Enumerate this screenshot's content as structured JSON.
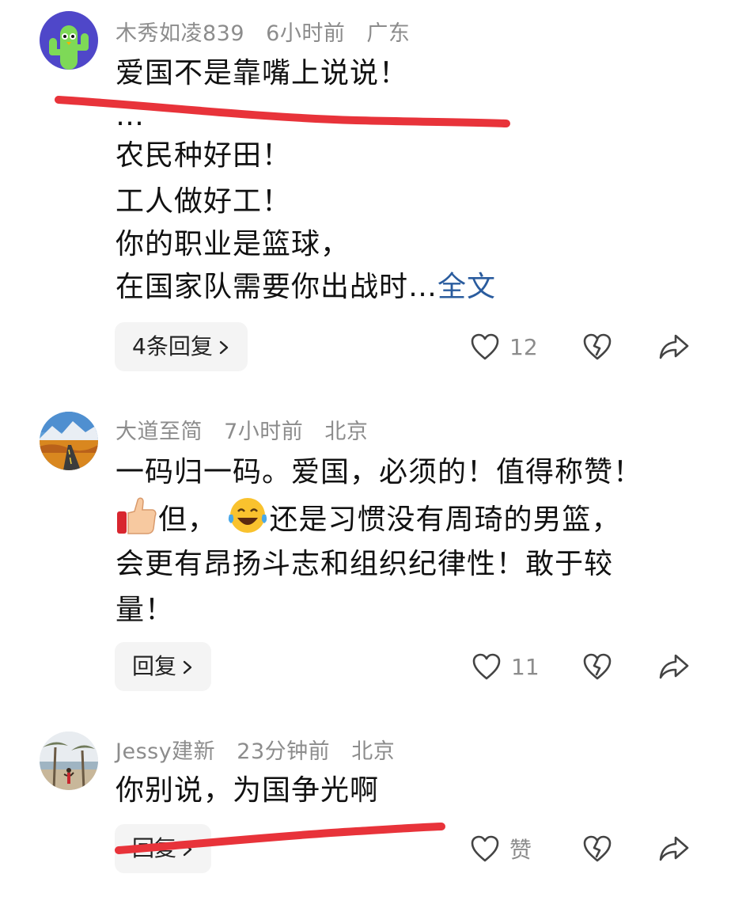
{
  "colors": {
    "background": "#ffffff",
    "text": "#111111",
    "meta": "#8c8c8c",
    "link": "#2a5c9e",
    "reply_bg": "#f4f4f4",
    "annotation": "#e8333a"
  },
  "comments": [
    {
      "username": "木秀如凌839",
      "time": "6小时前",
      "location": "广东",
      "avatar": "cactus-avatar",
      "lines": [
        "爱国不是靠嘴上说说！",
        "…",
        "农民种好田！",
        "工人做好工！",
        "你的职业是篮球，",
        "在国家队需要你出战时…"
      ],
      "more_label": "全文",
      "reply_label": "4条回复",
      "like_count": "12"
    },
    {
      "username": "大道至简",
      "time": "7小时前",
      "location": "北京",
      "avatar": "autumn-road-avatar",
      "line1": "一码归一码。爱国，必须的！值得称赞！",
      "line2": "但，",
      "line2b": "还是习惯没有周琦的男篮，",
      "line3": "会更有昂扬斗志和组织纪律性！敢于较",
      "line4": "量！",
      "reply_label": "回复",
      "like_count": "11"
    },
    {
      "username": "Jessy建新",
      "time": "23分钟前",
      "location": "北京",
      "avatar": "beach-palm-avatar",
      "text": "你别说，为国争光啊",
      "reply_label": "回复",
      "like_count": "赞"
    }
  ]
}
